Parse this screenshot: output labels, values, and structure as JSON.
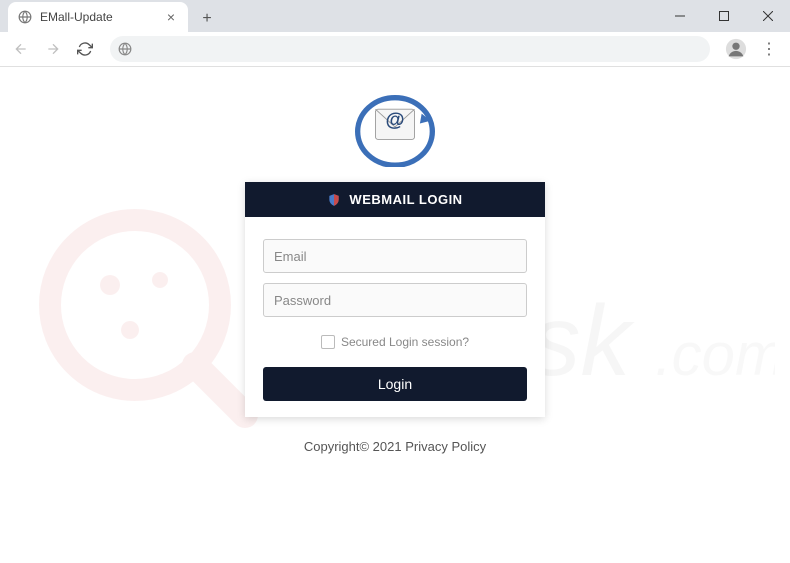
{
  "browser": {
    "tab_title": "EMall-Update",
    "url": ""
  },
  "page": {
    "header_title": "WEBMAIL LOGIN",
    "email_placeholder": "Email",
    "password_placeholder": "Password",
    "secured_label": "Secured Login session?",
    "login_button": "Login",
    "footer": "Copyright© 2021 Privacy Policy",
    "watermark_text": "PCrisk.com"
  }
}
